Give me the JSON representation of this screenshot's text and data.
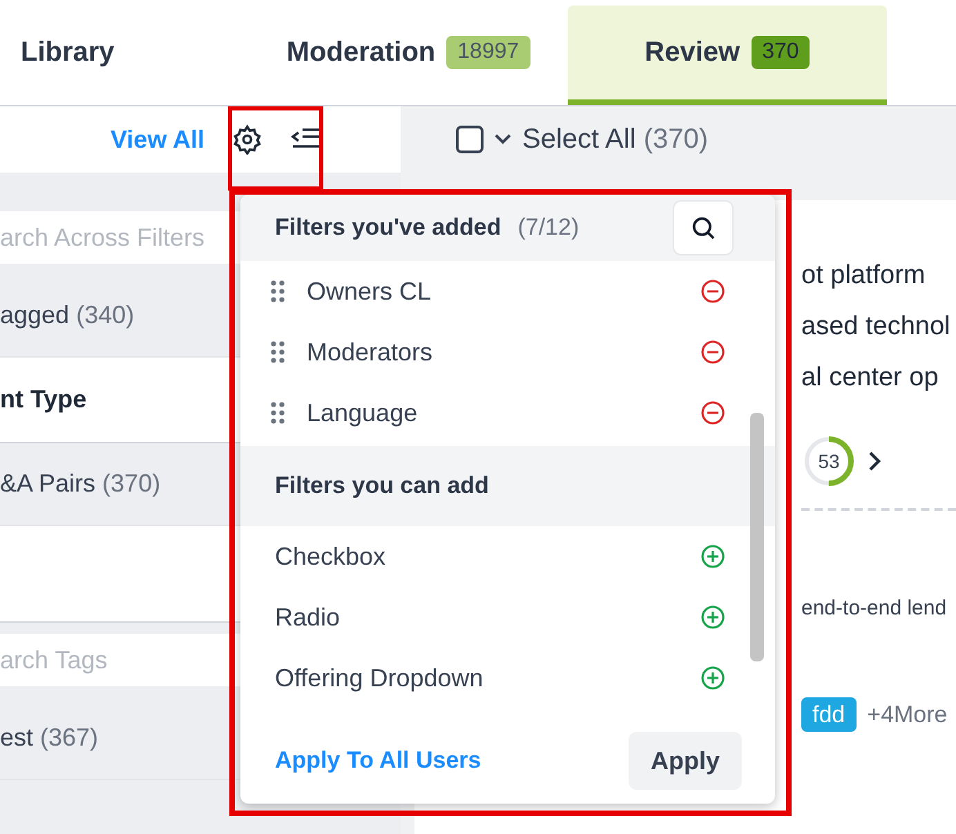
{
  "tabs": [
    {
      "label": "Library",
      "selected": false
    },
    {
      "label": "Moderation",
      "badge": "18997",
      "selected": false
    },
    {
      "label": "Review",
      "badge": "370",
      "selected": true
    }
  ],
  "sidebar": {
    "view_all": "View All",
    "rows": [
      {
        "kind": "search",
        "placeholder": "arch Across Filters"
      },
      {
        "kind": "option",
        "label": "agged",
        "count": "(340)"
      },
      {
        "kind": "header",
        "label": "nt Type"
      },
      {
        "kind": "option",
        "label": "&A Pairs",
        "count": "(370)"
      },
      {
        "kind": "spacer"
      },
      {
        "kind": "search",
        "placeholder": "arch Tags"
      },
      {
        "kind": "option",
        "label": "est",
        "count": "(367)"
      }
    ]
  },
  "select_all": {
    "label": "Select All",
    "count": "(370)",
    "checked": false
  },
  "card": {
    "lines": [
      "ot platform",
      "ased technol",
      "al center op"
    ],
    "score": {
      "value": "53",
      "level": 0.5
    },
    "snippet": "end-to-end lend",
    "tags": [
      "fdd"
    ],
    "more": "+4More"
  },
  "popup": {
    "added_title": "Filters you've added",
    "added_count": "(7/12)",
    "added": [
      "Owners CL",
      "Moderators",
      "Language"
    ],
    "available_title": "Filters you can add",
    "available": [
      "Checkbox",
      "Radio",
      "Offering Dropdown"
    ],
    "link": "Apply To All Users",
    "button": "Apply"
  }
}
